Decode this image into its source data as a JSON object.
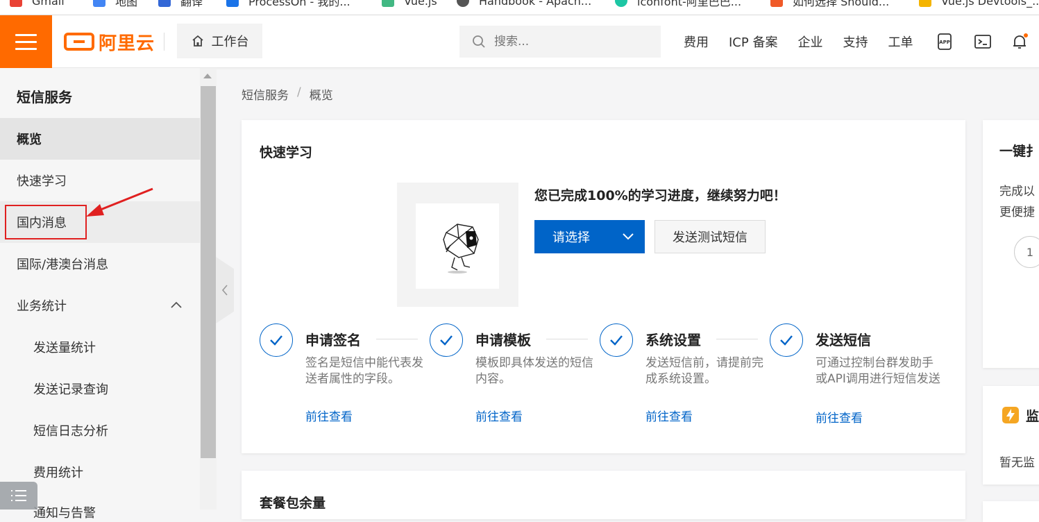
{
  "bookmarks": [
    "Gmail",
    "地图",
    "翻译",
    "ProcessOn - 我的...",
    "Vue.js",
    "Handbook - Apach...",
    "iconfont-阿里巴巴...",
    "如何选择 Should...",
    "Vue.js Devtools_..."
  ],
  "topbar": {
    "logo_text": "阿里云",
    "workbench_label": "工作台",
    "search_placeholder": "搜索...",
    "nav_links": [
      "费用",
      "ICP 备案",
      "企业",
      "支持",
      "工单"
    ]
  },
  "sidebar": {
    "title": "短信服务",
    "items": [
      {
        "label": "概览",
        "state": "active"
      },
      {
        "label": "快速学习"
      },
      {
        "label": "国内消息",
        "state": "hover"
      },
      {
        "label": "国际/港澳台消息"
      },
      {
        "label": "业务统计",
        "expanded": true
      },
      {
        "label": "发送量统计",
        "sub": true
      },
      {
        "label": "发送记录查询",
        "sub": true
      },
      {
        "label": "短信日志分析",
        "sub": true
      },
      {
        "label": "费用统计",
        "sub": true
      }
    ],
    "partial_item": "通知与告警"
  },
  "breadcrumb": {
    "root": "短信服务",
    "sep": "/",
    "current": "概览"
  },
  "quick_learn": {
    "title": "快速学习",
    "progress_message": "您已完成100%的学习进度，继续努力吧！",
    "select_button": "请选择",
    "test_button": "发送测试短信",
    "steps": [
      {
        "title": "申请签名",
        "desc": "签名是短信中能代表发送者属性的字段。",
        "link": "前往查看"
      },
      {
        "title": "申请模板",
        "desc": "模板即具体发送的短信内容。",
        "link": "前往查看"
      },
      {
        "title": "系统设置",
        "desc": "发送短信前，请提前完成系统设置。",
        "link": "前往查看"
      },
      {
        "title": "发送短信",
        "desc": "可通过控制台群发助手或API调用进行短信发送",
        "link": "前往查看"
      }
    ]
  },
  "package": {
    "title": "套餐包余量"
  },
  "right_panel": {
    "card1_title": "一键扌",
    "card1_line1": "完成以",
    "card1_line2": "更便捷",
    "card1_step": "1",
    "card2_title": "监",
    "card2_text": "暂无监"
  },
  "colors": {
    "brand_orange": "#ff6a00",
    "primary_blue": "#0064c8",
    "annotation_red": "#e02020"
  }
}
